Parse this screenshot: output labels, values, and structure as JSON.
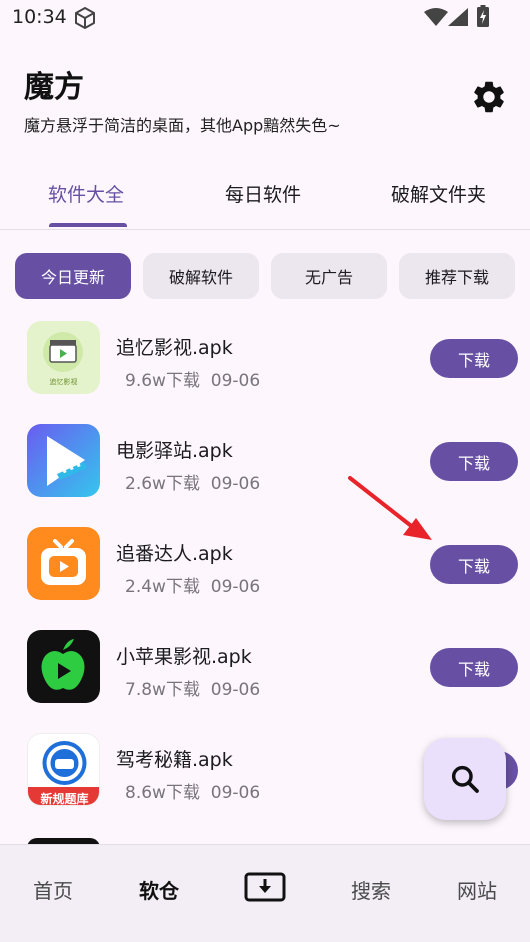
{
  "status_bar": {
    "time": "10:34",
    "icons": [
      "cube-icon",
      "wifi-icon",
      "signal-icon",
      "battery-icon"
    ]
  },
  "header": {
    "title": "魔方",
    "subtitle": "魔方悬浮于简洁的桌面，其他App黯然失色~",
    "settings_icon": "gear-icon"
  },
  "tabs": [
    {
      "label": "软件大全",
      "active": true
    },
    {
      "label": "每日软件",
      "active": false
    },
    {
      "label": "破解文件夹",
      "active": false
    }
  ],
  "chips": [
    {
      "label": "今日更新",
      "selected": true
    },
    {
      "label": "破解软件",
      "selected": false
    },
    {
      "label": "无广告",
      "selected": false
    },
    {
      "label": "推荐下载",
      "selected": false
    }
  ],
  "apps": [
    {
      "name": "追忆影视.apk",
      "downloads": "9.6w下载",
      "date": "09-06",
      "button": "下载",
      "icon": "film-clapper-icon",
      "icon_text": "追忆影视"
    },
    {
      "name": "电影驿站.apk",
      "downloads": "2.6w下载",
      "date": "09-06",
      "button": "下载",
      "icon": "play-film-icon"
    },
    {
      "name": "追番达人.apk",
      "downloads": "2.4w下载",
      "date": "09-06",
      "button": "下载",
      "icon": "tv-replay-icon"
    },
    {
      "name": "小苹果影视.apk",
      "downloads": "7.8w下载",
      "date": "09-06",
      "button": "下载",
      "icon": "apple-play-icon"
    },
    {
      "name": "驾考秘籍.apk",
      "downloads": "8.6w下载",
      "date": "09-06",
      "button": "下载",
      "icon": "steering-car-icon",
      "icon_text": "新规题库"
    }
  ],
  "fab_icon": "search-icon",
  "bottom_nav": [
    {
      "label": "首页",
      "active": false
    },
    {
      "label": "软仓",
      "active": true
    },
    {
      "icon": "download-box-icon"
    },
    {
      "label": "搜索",
      "active": false
    },
    {
      "label": "网站",
      "active": false
    }
  ],
  "colors": {
    "accent": "#6750a4",
    "chip_bg": "#ece6ee",
    "fab_bg": "#eae0fb",
    "arrow": "#e8232a"
  }
}
